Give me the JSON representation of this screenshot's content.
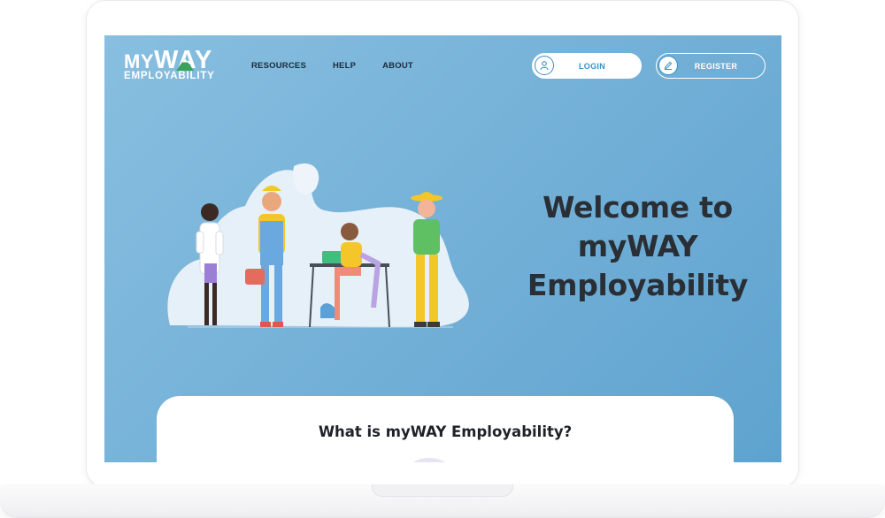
{
  "logo": {
    "line1_my": "MY",
    "line1_way": "WAY",
    "line2": "EMPLOYABILITY"
  },
  "nav": {
    "items": [
      {
        "label": "RESOURCES"
      },
      {
        "label": "HELP"
      },
      {
        "label": "ABOUT"
      }
    ]
  },
  "auth": {
    "login_label": "LOGIN",
    "register_label": "REGISTER",
    "login_icon": "user-icon",
    "register_icon": "pencil-icon"
  },
  "hero": {
    "title_line1": "Welcome to",
    "title_line2": "myWAY",
    "title_line3": "Employability",
    "illustration": "workers-illustration"
  },
  "info_card": {
    "title": "What is myWAY Employability?"
  },
  "colors": {
    "screen_bg_start": "#88bfe0",
    "screen_bg_end": "#5ea3cf",
    "accent_blue": "#3a8fc4",
    "title_text": "#2a2e35"
  }
}
